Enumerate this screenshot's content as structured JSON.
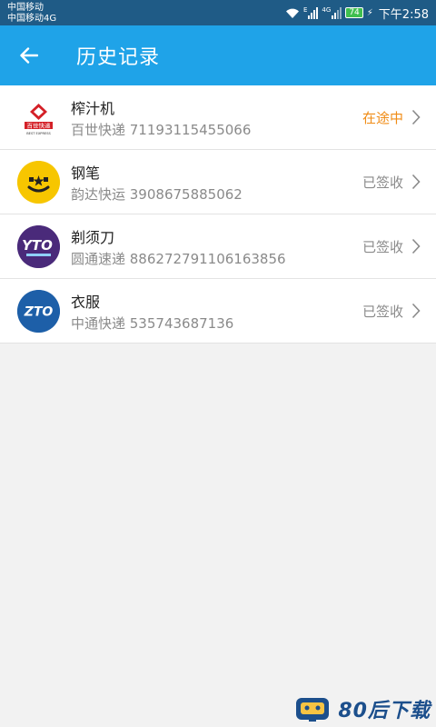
{
  "status_bar": {
    "carrier_1": "中国移动",
    "carrier_2": "中国移动4G",
    "sig1_tag": "E",
    "sig2_tag": "4G",
    "battery": "74",
    "time": "下午2:58"
  },
  "header": {
    "title": "历史记录",
    "back_icon": "arrow-left-icon"
  },
  "records": [
    {
      "name": "榨汁机",
      "tracking": "百世快递 71193115455066",
      "status": "在途中",
      "status_color": "#f08c16",
      "logo_text": "百世快递",
      "logo_sub": "BEST EXPRESS"
    },
    {
      "name": "钢笔",
      "tracking": "韵达快运 3908675885062",
      "status": "已签收",
      "status_color": "#8a8a8a"
    },
    {
      "name": "剃须刀",
      "tracking": "圆通速递 886272791106163856",
      "status": "已签收",
      "status_color": "#8a8a8a",
      "logo_text": "YTO"
    },
    {
      "name": "衣服",
      "tracking": "中通快递 535743687136",
      "status": "已签收",
      "status_color": "#8a8a8a",
      "logo_text": "ZTO"
    }
  ],
  "watermark": {
    "text": "80后下载"
  },
  "colors": {
    "status_bar": "#1f5b86",
    "app_bar": "#1fa3e8",
    "in_transit": "#f08c16",
    "signed": "#8a8a8a"
  }
}
